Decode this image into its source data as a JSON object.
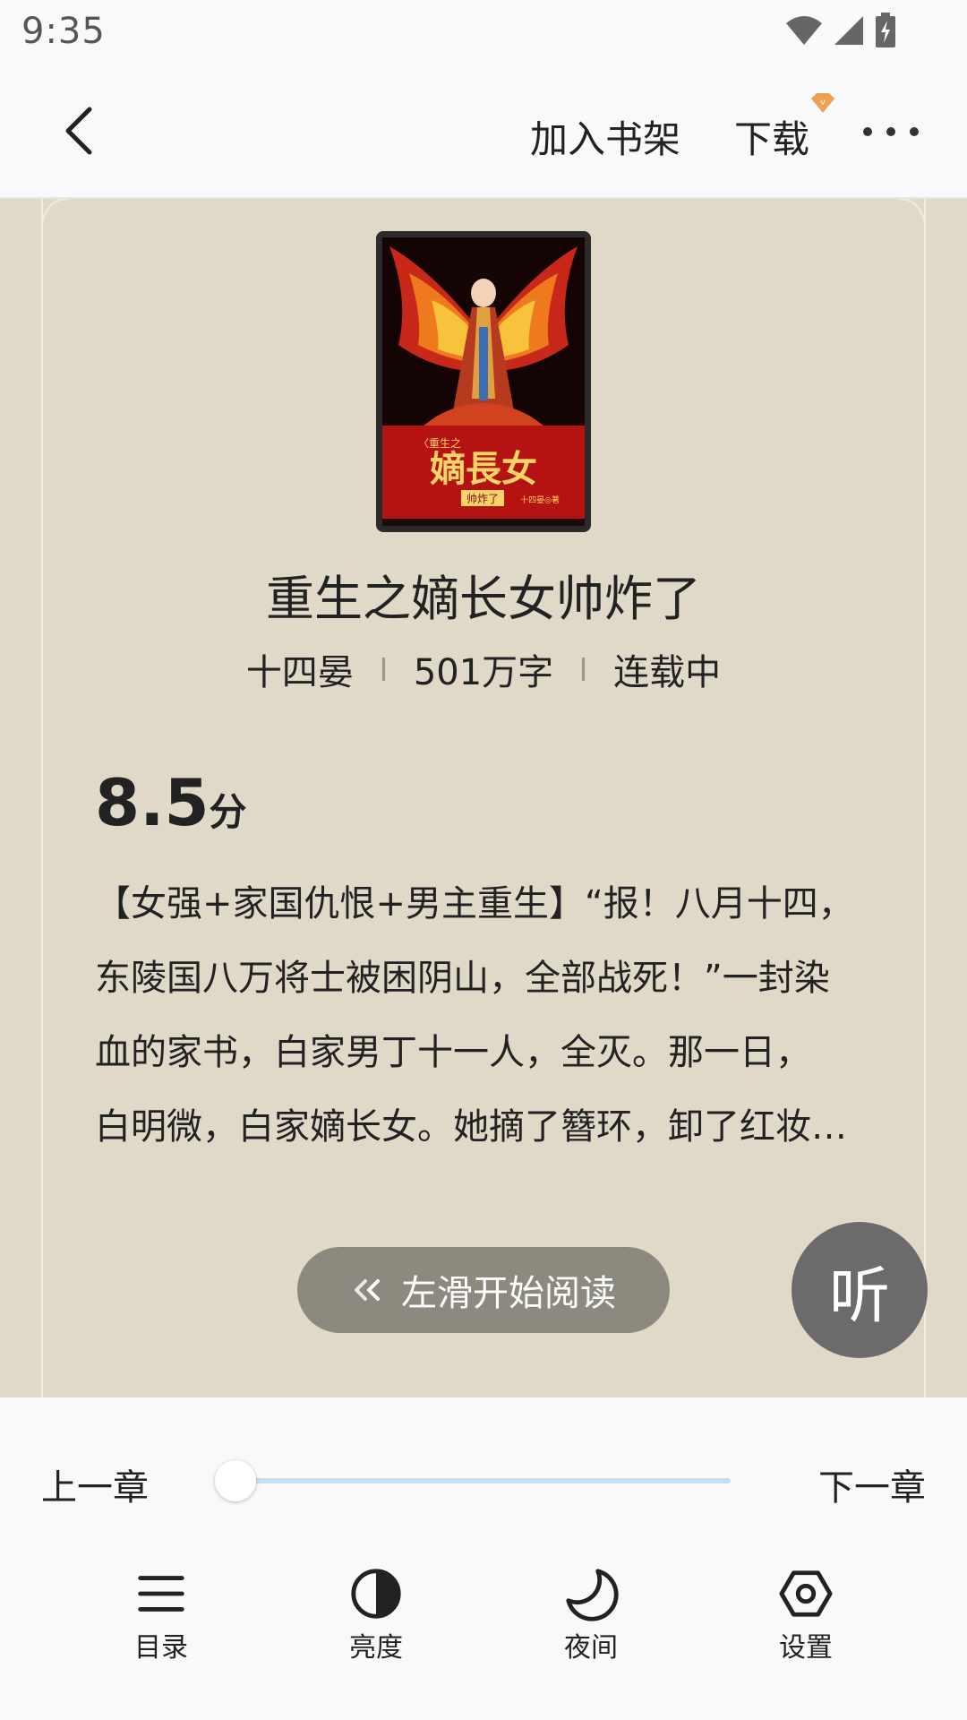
{
  "status_bar": {
    "time": "9:35"
  },
  "top_bar": {
    "add_to_shelf": "加入书架",
    "download": "下载",
    "vip_badge": "v"
  },
  "book": {
    "title": "重生之嫡长女帅炸了",
    "author": "十四晏",
    "word_count": "501万字",
    "status": "连载中",
    "score": "8.5",
    "score_unit": "分",
    "summary_lines": [
      "【女强+家国仇恨+男主重生】“报！八月十四，",
      "东陵国八万将士被困阴山，全部战死！”一封染",
      "血的家书，白家男丁十一人，全灭。那一日，",
      "白明微，白家嫡长女。她摘了簪环，卸了红妆…"
    ],
    "cover_text": {
      "subtitle": "〈重生之",
      "main": "嫡長女",
      "tag": "帅炸了",
      "author": "十四晏◎著"
    }
  },
  "actions": {
    "swipe_to_read": "左滑开始阅读",
    "listen": "听"
  },
  "chapter_nav": {
    "prev": "上一章",
    "next": "下一章",
    "progress": 0
  },
  "bottom_nav": [
    {
      "label": "目录",
      "icon": "list-icon"
    },
    {
      "label": "亮度",
      "icon": "brightness-icon"
    },
    {
      "label": "夜间",
      "icon": "moon-icon"
    },
    {
      "label": "设置",
      "icon": "settings-icon"
    }
  ],
  "colors": {
    "reader_bg": "#e0d9c8",
    "panel_bg": "#f8f9fb",
    "swipe_btn": "#8c8a7e",
    "listen_btn": "#6b6b6b",
    "slider_track": "#c8def2",
    "vip_badge": "#f0a050"
  }
}
